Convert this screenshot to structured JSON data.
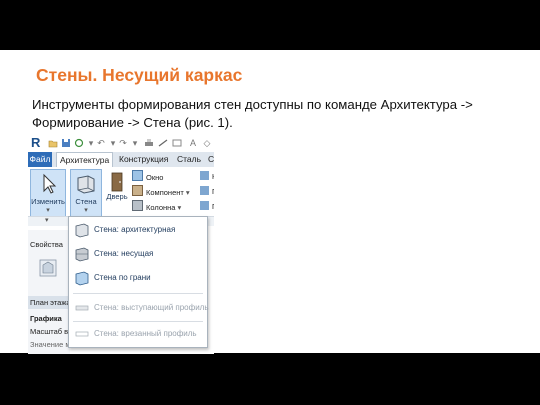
{
  "title": "Стены. Несущий каркас",
  "body": {
    "line1": "Инструменты формирования стен доступны по команде Архитектура ->",
    "line2": "Формирование -> Стена (рис. 1)."
  },
  "revit": {
    "logo": "R",
    "tabs": [
      "Файл",
      "Архитектура",
      "Конструкция",
      "Сталь",
      "С"
    ],
    "active_tab": "Архитектура",
    "ribbon": {
      "modify_label": "Изменить",
      "wall_label": "Стена",
      "door_label": "Дверь",
      "window_label": "Окно",
      "component_label": "Компонент",
      "column_label": "Колонна",
      "cut1": "К",
      "cut2": "П",
      "cut3": "П"
    },
    "properties": {
      "header": "Свойства",
      "plan_label": "План этажа",
      "graphics_label": "Графика",
      "scale_label": "Масштаб в",
      "value_label": "Значение м"
    },
    "wall_menu": [
      {
        "label": "Стена: архитектурная",
        "enabled": true
      },
      {
        "label": "Стена: несущая",
        "enabled": true
      },
      {
        "label": "Стена по грани",
        "enabled": true
      },
      {
        "label": "Стена: выступающий профиль",
        "enabled": false
      },
      {
        "label": "Стена: врезанный профиль",
        "enabled": false
      }
    ],
    "colors": {
      "accent": "#e8762d",
      "file_tab": "#2d6cb8",
      "logo": "#1c4f8a"
    }
  }
}
